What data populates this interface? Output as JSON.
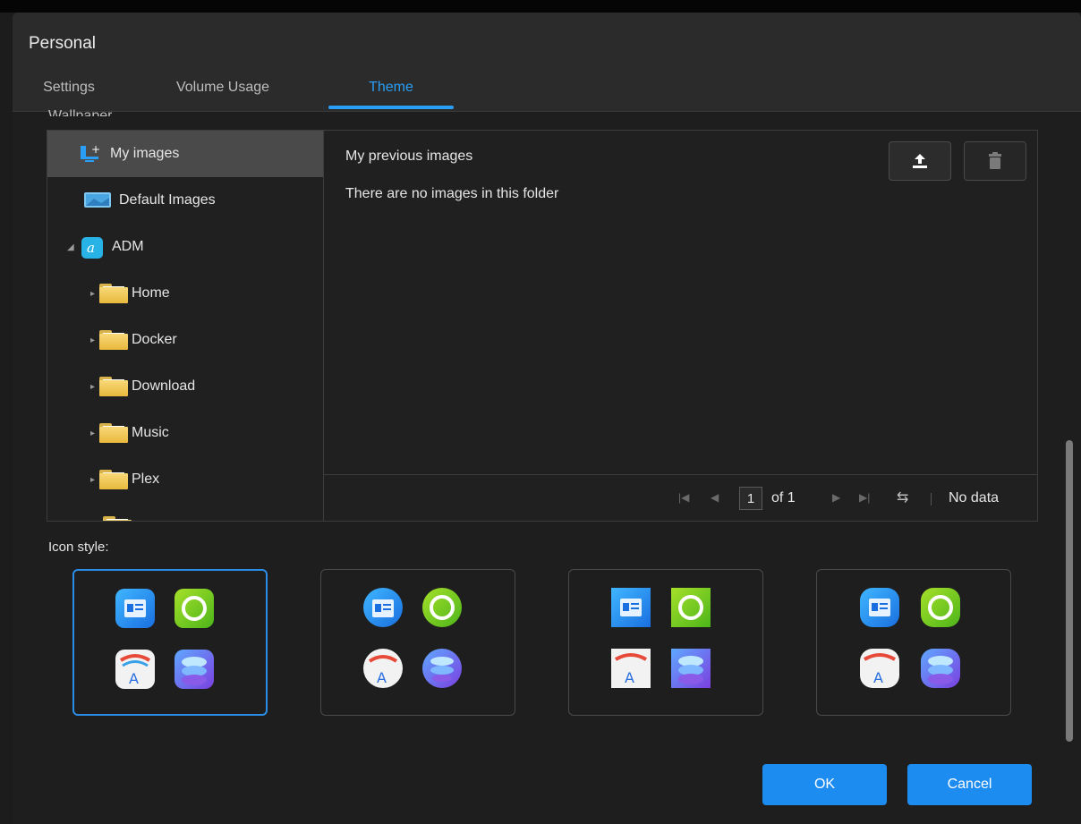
{
  "window": {
    "title": "Personal"
  },
  "tabs": [
    {
      "label": "Settings"
    },
    {
      "label": "Volume Usage"
    },
    {
      "label": "Theme",
      "active": true
    }
  ],
  "wallpaper": {
    "section_label": "Wallpaper",
    "tree": [
      {
        "label": "My images",
        "icon": "monitor-add-icon",
        "selected": true
      },
      {
        "label": "Default Images",
        "icon": "monitor-icon"
      },
      {
        "label": "ADM",
        "icon": "adm-logo-icon",
        "expanded": true
      },
      {
        "label": "Home",
        "icon": "folder-icon"
      },
      {
        "label": "Docker",
        "icon": "folder-icon"
      },
      {
        "label": "Download",
        "icon": "folder-icon"
      },
      {
        "label": "Music",
        "icon": "folder-icon"
      },
      {
        "label": "Plex",
        "icon": "folder-icon"
      }
    ],
    "pane_title": "My previous images",
    "empty_message": "There are no images in this folder",
    "pager": {
      "page": "1",
      "of_text": "of 1",
      "status": "No data"
    }
  },
  "icon_style": {
    "label": "Icon style:",
    "options": [
      {
        "shape": "rounded-square",
        "selected": true
      },
      {
        "shape": "circle"
      },
      {
        "shape": "square"
      },
      {
        "shape": "squircle"
      }
    ]
  },
  "buttons": {
    "ok": "OK",
    "cancel": "Cancel"
  },
  "colors": {
    "accent": "#2a9df4",
    "button": "#1d8cf0",
    "background": "#1e1e1e",
    "header": "#2b2b2b"
  }
}
